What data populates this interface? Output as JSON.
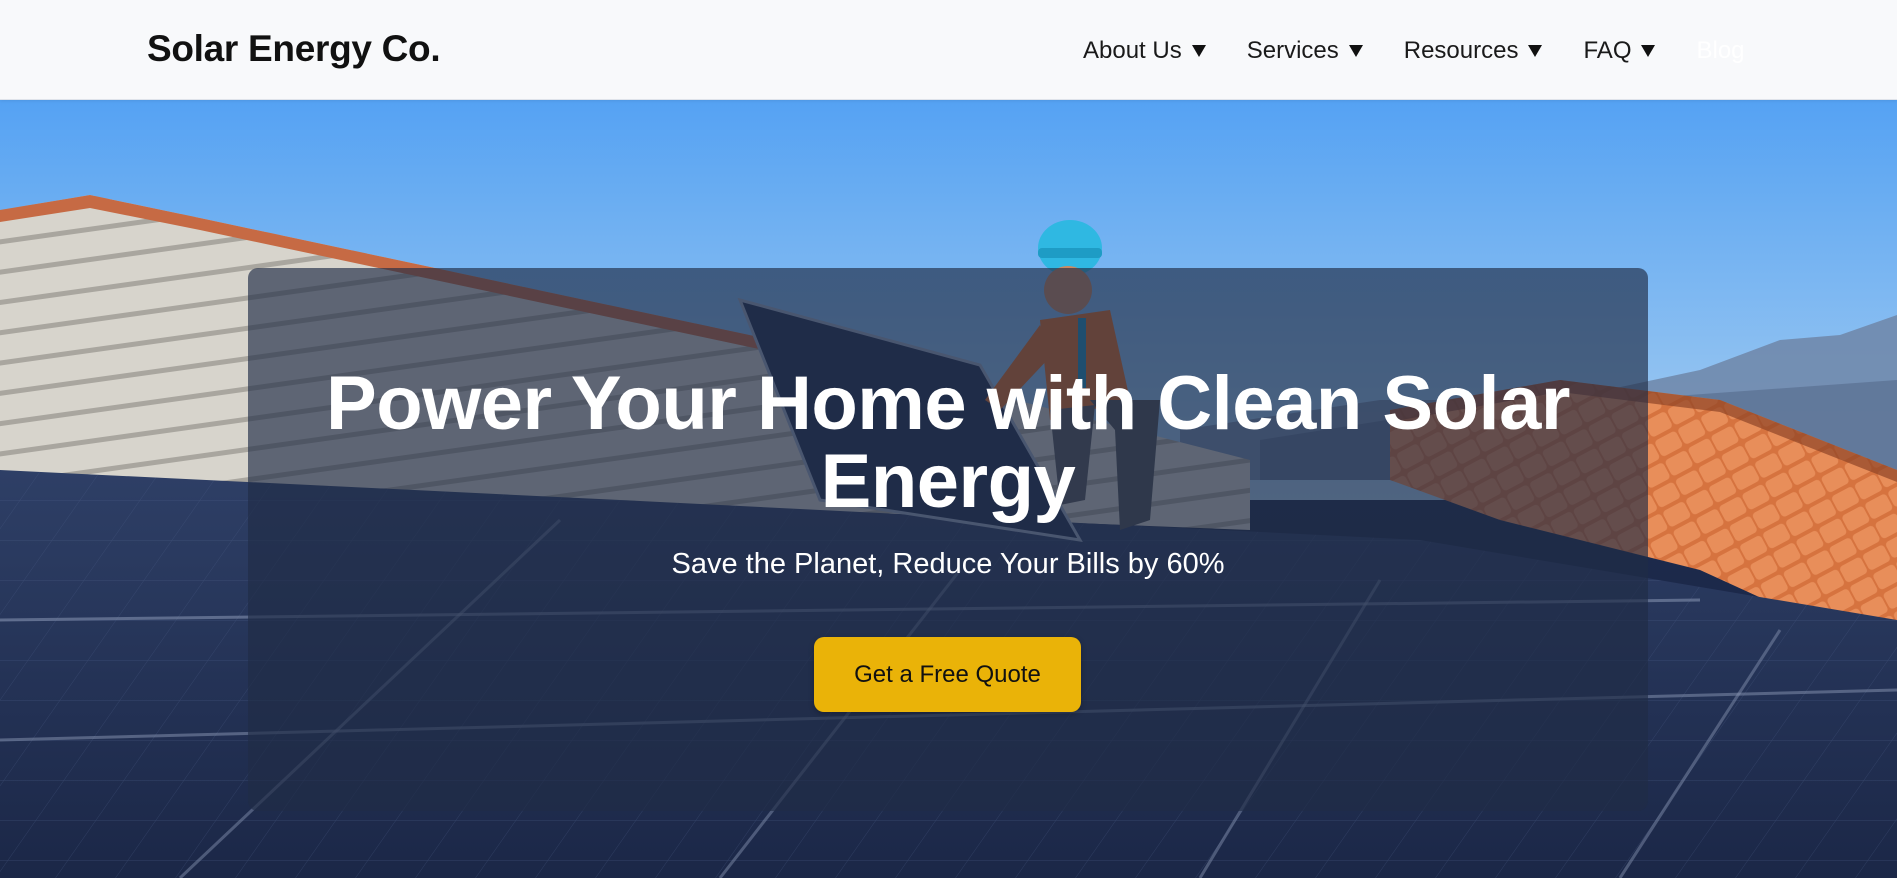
{
  "brand": {
    "name": "Solar Energy Co."
  },
  "nav": {
    "items": [
      {
        "label": "About Us",
        "has_dropdown": true
      },
      {
        "label": "Services",
        "has_dropdown": true
      },
      {
        "label": "Resources",
        "has_dropdown": true
      },
      {
        "label": "FAQ",
        "has_dropdown": true
      },
      {
        "label": "Blog",
        "has_dropdown": false
      }
    ],
    "caret_icon": "caret-down-icon"
  },
  "hero": {
    "title": "Power Your Home with Clean Solar Energy",
    "subtitle": "Save the Planet, Reduce Your Bills by 60%",
    "cta_label": "Get a Free Quote",
    "image_icon": "solar-roof-worker-photo"
  },
  "colors": {
    "accent": "#eab308",
    "navbar_bg": "#f8f9fb",
    "overlay": "rgba(32,44,70,0.66)",
    "text_dark": "#111111",
    "text_light": "#ffffff"
  }
}
